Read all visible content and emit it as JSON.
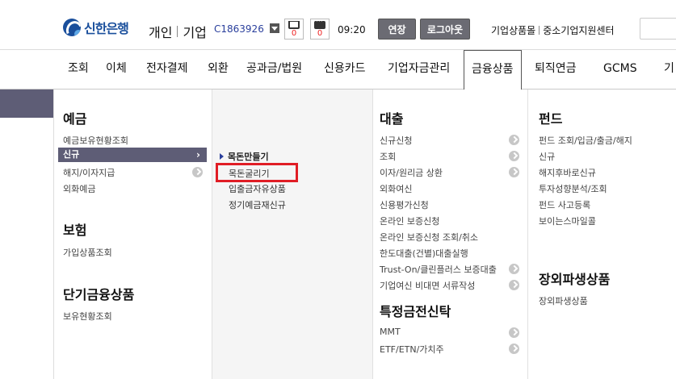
{
  "header": {
    "logo_text": "신한은행",
    "mode_tabs": [
      "개인",
      "기업"
    ],
    "user_id": "C1863926",
    "cart_count": "0",
    "msg_count": "0",
    "time": "09:20",
    "extend_label": "연장",
    "logout_label": "로그아웃",
    "util_links": [
      "기업상품몰",
      "중소기업지원센터"
    ]
  },
  "gnb": {
    "items": [
      "조회",
      "이체",
      "전자결제",
      "외환",
      "공과금/법원",
      "신용카드",
      "기업자금관리",
      "금융상품",
      "퇴직연금",
      "GCMS",
      "기"
    ],
    "active": "금융상품"
  },
  "menu": {
    "deposit": {
      "heading": "예금",
      "items": [
        "예금보유현황조회",
        "신규",
        "해지/이자지급",
        "외화예금"
      ],
      "selected": "신규"
    },
    "insurance": {
      "heading": "보험",
      "items": [
        "가입상품조회"
      ]
    },
    "short_term": {
      "heading": "단기금융상품",
      "items": [
        "보유현황조회"
      ]
    },
    "new_submenu": {
      "items": [
        "목돈만들기",
        "목돈굴리기",
        "입출금자유상품",
        "정기예금재신규"
      ],
      "current": "목돈만들기",
      "highlighted": "목돈굴리기"
    },
    "loan": {
      "heading": "대출",
      "items": [
        "신규신청",
        "조회",
        "이자/원리금 상환",
        "외화여신",
        "신용평가신청",
        "온라인 보증신청",
        "온라인 보증신청 조회/취소",
        "한도대출(건별)대출실행",
        "Trust-On/클린플러스 보증대출",
        "기업여신 비대면 서류작성"
      ]
    },
    "trust": {
      "heading": "특정금전신탁",
      "items": [
        "MMT",
        "ETF/ETN/가치주"
      ]
    },
    "fund": {
      "heading": "펀드",
      "items": [
        "펀드 조회/입금/출금/해지",
        "신규",
        "해지후바로신규",
        "투자성향분석/조회",
        "펀드 사고등록",
        "보이는스마일콜"
      ]
    },
    "derivatives": {
      "heading": "장외파생상품",
      "items": [
        "장외파생상품"
      ]
    }
  },
  "colors": {
    "accent": "#5e5d76",
    "brand": "#1a4f9c",
    "highlight": "#e01d25"
  }
}
